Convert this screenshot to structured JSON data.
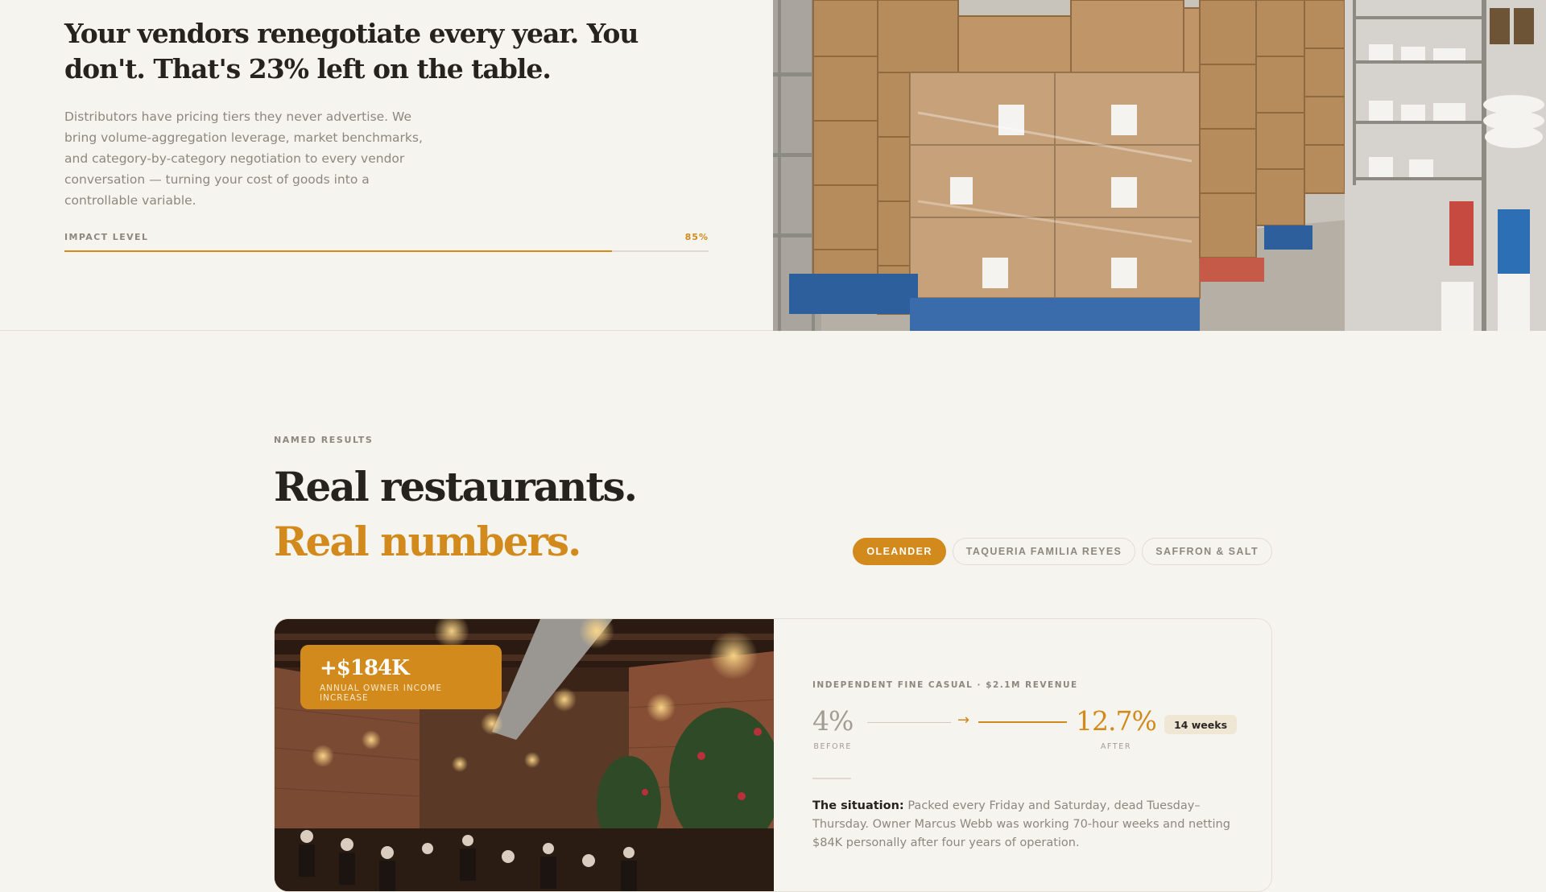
{
  "top": {
    "headline": "Your vendors renegotiate every year. You don't. That's 23% left on the table.",
    "body": "Distributors have pricing tiers they never advertise. We bring volume-aggregation leverage, market benchmarks, and category-by-category negotiation to every vendor conversation — turning your cost of goods into a controllable variable.",
    "impact_label": "IMPACT LEVEL",
    "impact_value": "85%",
    "impact_fraction": 0.85
  },
  "results": {
    "eyebrow": "NAMED RESULTS",
    "title_line1": "Real restaurants.",
    "title_line2": "Real numbers.",
    "tabs": [
      {
        "label": "OLEANDER",
        "active": true
      },
      {
        "label": "TAQUERIA FAMILIA REYES",
        "active": false
      },
      {
        "label": "SAFFRON & SALT",
        "active": false
      }
    ],
    "case": {
      "badge_value": "+$184K",
      "badge_label": "ANNUAL OWNER INCOME INCREASE",
      "eyebrow": "INDEPENDENT FINE CASUAL · $2.1M REVENUE",
      "before_value": "4%",
      "before_label": "BEFORE",
      "after_value": "12.7%",
      "after_label": "AFTER",
      "duration": "14 weeks",
      "situation_label": "The situation:",
      "situation_text": "Packed every Friday and Saturday, dead Tuesday–Thursday. Owner Marcus Webb was working 70-hour weeks and netting $84K personally after four years of operation."
    }
  },
  "colors": {
    "accent": "#d18a1b",
    "background": "#f6f4ef",
    "heading": "#26231f",
    "muted": "#8c8880"
  },
  "icons": {
    "arrow": "arrow-right-icon"
  }
}
